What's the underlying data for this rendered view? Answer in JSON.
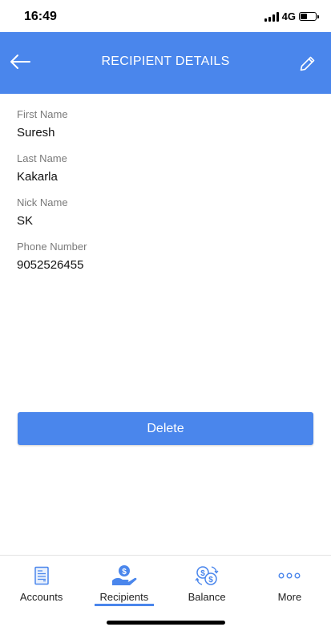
{
  "status_bar": {
    "time": "16:49",
    "network": "4G",
    "battery_level": 0.45
  },
  "header": {
    "title": "RECIPIENT DETAILS",
    "back_icon": "arrow-left-icon",
    "edit_icon": "pencil-icon"
  },
  "recipient": {
    "fields": [
      {
        "label": "First Name",
        "value": "Suresh"
      },
      {
        "label": "Last Name",
        "value": "Kakarla"
      },
      {
        "label": "Nick Name",
        "value": "SK"
      },
      {
        "label": "Phone Number",
        "value": "9052526455"
      }
    ]
  },
  "actions": {
    "delete_label": "Delete"
  },
  "tabbar": {
    "active": "Recipients",
    "tabs": [
      {
        "label": "Accounts",
        "icon": "document-icon"
      },
      {
        "label": "Recipients",
        "icon": "hand-money-icon"
      },
      {
        "label": "Balance",
        "icon": "currency-exchange-icon"
      },
      {
        "label": "More",
        "icon": "more-dots-icon"
      }
    ]
  },
  "colors": {
    "primary": "#4a86ec",
    "label": "#7a7a7a",
    "text": "#111111"
  }
}
